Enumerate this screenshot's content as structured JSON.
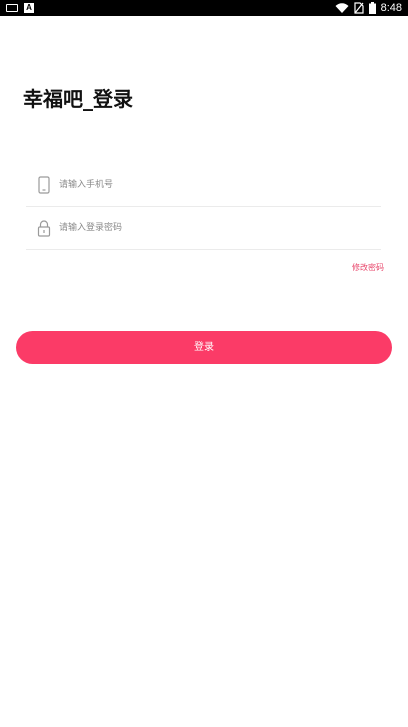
{
  "status_bar": {
    "time": "8:48",
    "left_icons": [
      "notification-icon",
      "app-a-icon"
    ],
    "right_icons": [
      "wifi-icon",
      "no-sim-icon",
      "battery-icon"
    ]
  },
  "page": {
    "title": "幸福吧_登录"
  },
  "form": {
    "phone": {
      "placeholder": "请输入手机号",
      "value": "",
      "icon": "phone-icon"
    },
    "password": {
      "placeholder": "请输入登录密码",
      "value": "",
      "icon": "lock-icon"
    },
    "forgot_label": "修改密码",
    "submit_label": "登录"
  },
  "colors": {
    "accent": "#fb3b67",
    "link": "#e8456a",
    "divider": "#ebebeb"
  }
}
